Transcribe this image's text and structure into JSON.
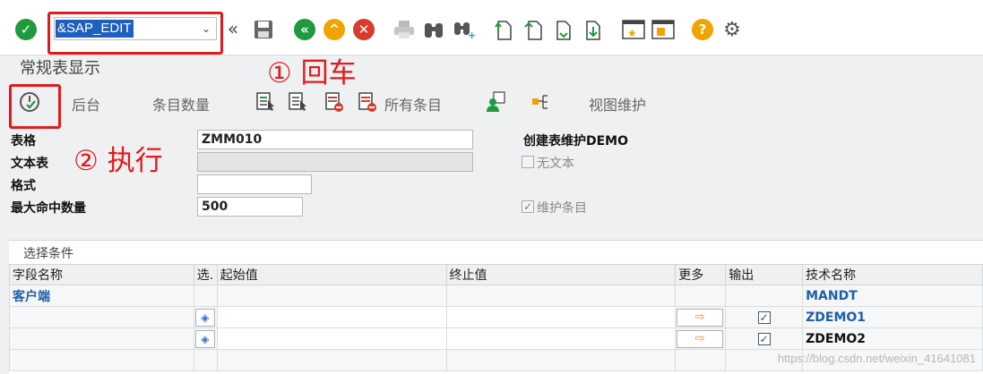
{
  "command_field": {
    "value": "&SAP_EDIT"
  },
  "page_title": "常规表显示",
  "annotations": {
    "step1": "① 回车",
    "step2": "② 执行"
  },
  "secondary_toolbar": {
    "background": "后台",
    "entry_count": "条目数量",
    "all_entries": "所有条目",
    "view_maintenance": "视图维护"
  },
  "form": {
    "table_label": "表格",
    "table_value": "ZMM010",
    "text_table_label": "文本表",
    "text_table_value": "",
    "layout_label": "格式",
    "layout_value": "",
    "max_hits_label": "最大命中数量",
    "max_hits_value": "500",
    "description": "创建表维护DEMO",
    "no_text_label": "无文本",
    "no_text_checked": false,
    "maintain_entries_label": "维护条目",
    "maintain_entries_checked": true
  },
  "selection": {
    "title": "选择条件",
    "headers": {
      "field_name": "字段名称",
      "sel": "选.",
      "from": "起始值",
      "to": "终止值",
      "more": "更多",
      "output": "输出",
      "tech_name": "技术名称"
    },
    "rows": [
      {
        "field": "客户端",
        "tech": "MANDT",
        "output_checked": false
      },
      {
        "field": "",
        "tech": "ZDEMO1",
        "output_checked": true
      },
      {
        "field": "",
        "tech": "ZDEMO2",
        "output_checked": true
      }
    ]
  },
  "watermark": "https://blog.csdn.net/weixin_41641081",
  "colors": {
    "highlight_red": "#e11b1b",
    "sap_green": "#1f9a3c",
    "sap_orange": "#f0a400",
    "sap_red": "#d83a2b",
    "tech_blue": "#1f5fa8"
  }
}
